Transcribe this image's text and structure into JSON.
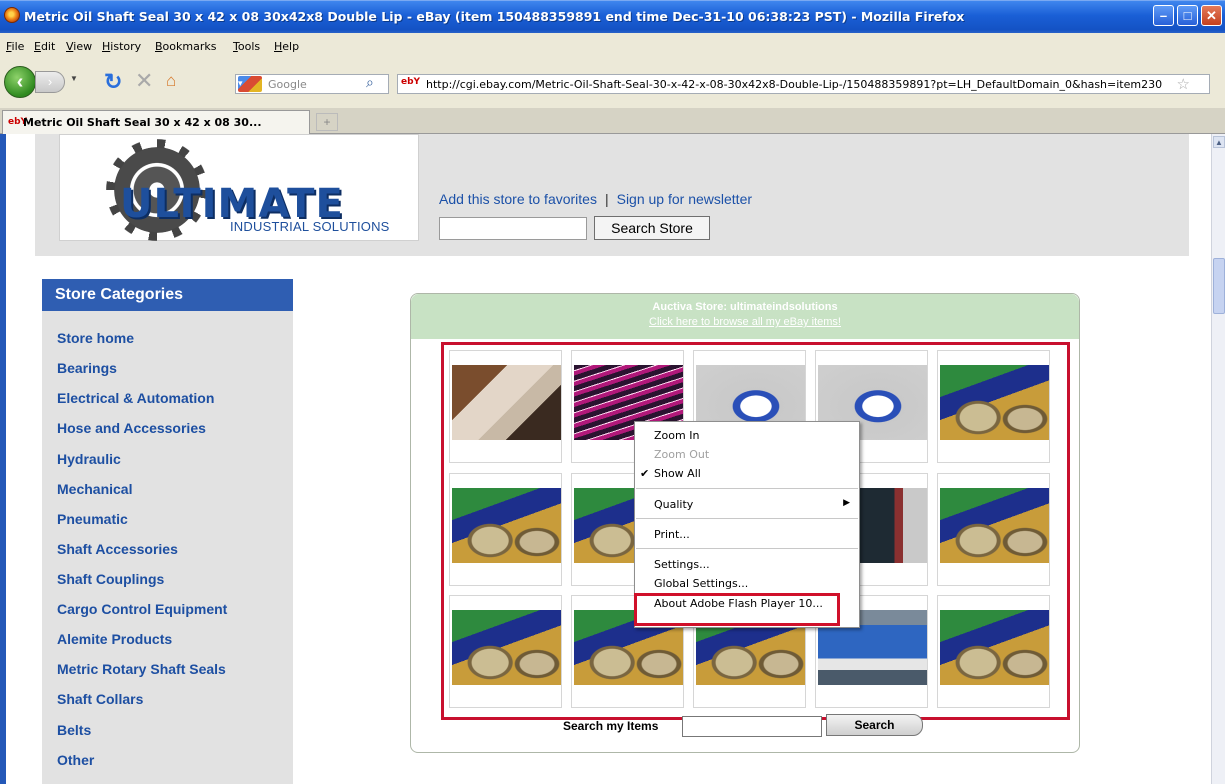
{
  "window": {
    "title": "Metric Oil Shaft Seal 30 x 42 x 08 30x42x8 Double Lip - eBay (item 150488359891 end time Dec-31-10 06:38:23 PST) - Mozilla Firefox",
    "controls": [
      "minimize",
      "maximize",
      "close"
    ]
  },
  "menubar": [
    "File",
    "Edit",
    "View",
    "History",
    "Bookmarks",
    "Tools",
    "Help"
  ],
  "navbar": {
    "search_placeholder": "Google",
    "url": "http://cgi.ebay.com/Metric-Oil-Shaft-Seal-30-x-42-x-08-30x42x8-Double-Lip-/150488359891?pt=LH_DefaultDomain_0&hash=item230"
  },
  "tab": {
    "label": "Metric Oil Shaft Seal 30 x 42 x 08 30...",
    "favicon": "ebY"
  },
  "header": {
    "logo_word": "ULTIMATE",
    "logo_sub": "INDUSTRIAL SOLUTIONS",
    "add_favorites": "Add this store to favorites",
    "separator": "|",
    "newsletter": "Sign up for newsletter",
    "search_button": "Search Store"
  },
  "categories": {
    "title": "Store Categories",
    "items": [
      "Store home",
      "Bearings",
      "Electrical & Automation",
      "Hose and Accessories",
      "Hydraulic",
      "Mechanical",
      "Pneumatic",
      "Shaft Accessories",
      "Shaft Couplings",
      "Cargo Control Equipment",
      "Alemite Products",
      "Metric Rotary Shaft Seals",
      "Shaft Collars",
      "Belts",
      "Other"
    ]
  },
  "auctiva": {
    "title": "Auctiva Store: ultimateindsolutions",
    "link": "Click here to browse all my eBay items!",
    "search_label": "Search my Items",
    "search_button": "Search"
  },
  "context_menu": {
    "items": [
      {
        "label": "Zoom In",
        "enabled": true
      },
      {
        "label": "Zoom Out",
        "enabled": false
      },
      {
        "label": "Show All",
        "enabled": true,
        "checked": true
      },
      {
        "label": "Quality",
        "enabled": true,
        "submenu": true
      },
      {
        "label": "Print...",
        "enabled": true
      },
      {
        "label": "Settings...",
        "enabled": true
      },
      {
        "label": "Global Settings...",
        "enabled": true
      },
      {
        "label": "About Adobe Flash Player 10...",
        "enabled": true,
        "highlighted": true
      }
    ]
  },
  "colors": {
    "titlebar": "#1a5fd6",
    "category_header": "#2f5eb2",
    "link": "#1c51a8",
    "highlight_box": "#c8102e",
    "auctiva_header": "#c8e2c4"
  }
}
